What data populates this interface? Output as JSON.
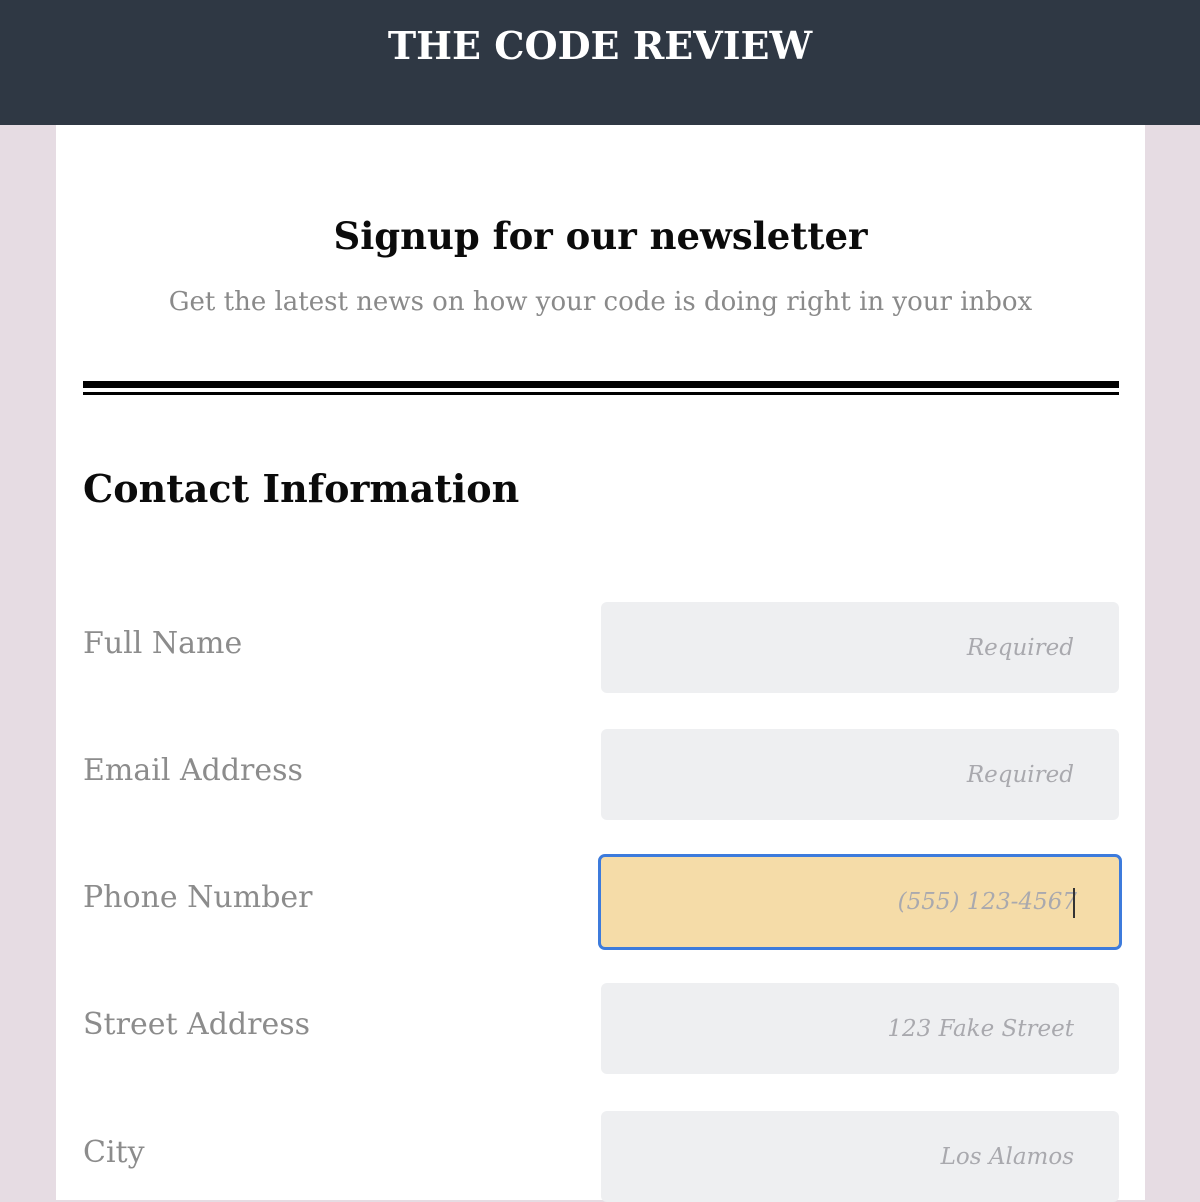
{
  "header": {
    "site_title": "THE CODE REVIEW"
  },
  "hero": {
    "title": "Signup for our newsletter",
    "subtitle": "Get the latest news on how your code is doing right in your inbox"
  },
  "contact_section": {
    "title": "Contact Information",
    "fields": [
      {
        "label": "Full Name",
        "placeholder": "Required",
        "value": ""
      },
      {
        "label": "Email Address",
        "placeholder": "Required",
        "value": ""
      },
      {
        "label": "Phone Number",
        "placeholder": "(555) 123-4567",
        "value": "",
        "focused": true
      },
      {
        "label": "Street Address",
        "placeholder": "123 Fake Street",
        "value": ""
      },
      {
        "label": "City",
        "placeholder": "Los Alamos",
        "value": ""
      }
    ]
  },
  "colors": {
    "header_bg": "#2f3844",
    "page_bg": "#e6dce3",
    "input_bg": "#eeeff1",
    "focused_input_bg": "#f5dca8",
    "focus_ring": "#3d7bdc"
  }
}
